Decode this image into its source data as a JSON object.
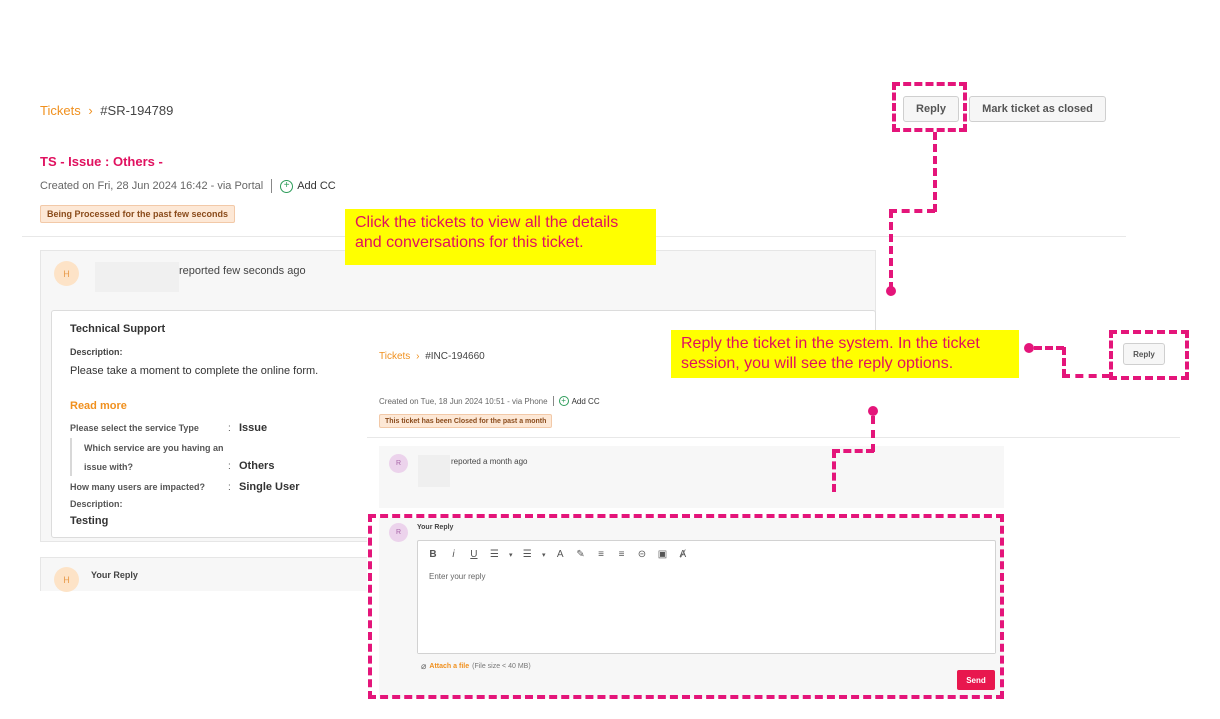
{
  "main": {
    "breadcrumb_link": "Tickets",
    "breadcrumb_sep": "›",
    "ticket_id": "#SR-194789",
    "title": "TS - Issue : Others -",
    "created": "Created on Fri, 28 Jun 2024 16:42 - via Portal",
    "add_cc": "Add CC",
    "status_badge": "Being Processed for the past few seconds",
    "reply_button": "Reply",
    "mark_closed_button": "Mark ticket as closed",
    "reporter_avatar": "H",
    "reported_text": "reported few seconds ago",
    "card_title": "Technical Support",
    "description_label": "Description:",
    "description_text": "Please take a moment to complete the online form.",
    "read_more": "Read more",
    "fields": [
      {
        "label": "Please select the service Type",
        "value": "Issue"
      },
      {
        "label": "Which service are you having an",
        "label2": "issue with?",
        "value": "Others"
      },
      {
        "label": "How many users are impacted?",
        "value": "Single User"
      }
    ],
    "description2_label": "Description:",
    "description2_text": "Testing",
    "your_reply_avatar": "H",
    "your_reply_label": "Your Reply",
    "field_colon": ":"
  },
  "overlay": {
    "breadcrumb_link": "Tickets",
    "breadcrumb_sep": "›",
    "ticket_id": "#INC-194660",
    "created": "Created on Tue, 18 Jun 2024 10:51 - via Phone",
    "add_cc": "Add CC",
    "status_badge": "This ticket has been Closed for the past a month",
    "reporter_avatar": "R",
    "reported_text": "reported a month ago",
    "your_reply_avatar": "R",
    "your_reply_label": "Your Reply",
    "editor_placeholder": "Enter your reply",
    "attach_label": "Attach a file",
    "attach_hint": "(File size < 40 MB)",
    "send_button": "Send",
    "toolbar": [
      "B",
      "i",
      "U",
      "☰",
      "▾",
      "☰",
      "▾",
      "A",
      "✎",
      "≡",
      "≡",
      "⊝",
      "▣",
      "Ⱥ"
    ]
  },
  "callouts": {
    "tickets": "Click the tickets to view all the details and conversations for this ticket.",
    "reply": "Reply the ticket in the system. In the ticket session, you will see the reply options."
  },
  "side_reply_button": "Reply",
  "colors": {
    "accent": "#f0901e",
    "title_pink": "#e0115f",
    "annotation": "#e4157a",
    "send": "#e8174e"
  }
}
